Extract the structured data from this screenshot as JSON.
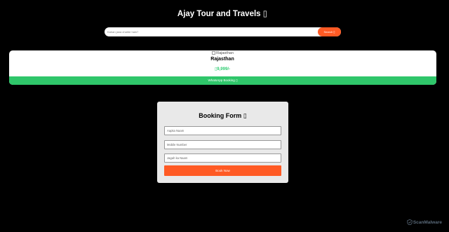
{
  "header": {
    "title": "Ajay Tour and Travels ▯"
  },
  "search": {
    "placeholder": "Kahan jana chahte hain?",
    "button_label": "Search ▯"
  },
  "package": {
    "image_alt": "Rajasthan",
    "name": "Rajasthan",
    "price": "▯9,999/-",
    "whatsapp_label": "WhatsApp Booking ▯",
    "colors": {
      "price": "#2ecc71",
      "whatsapp": "#2fc66a"
    }
  },
  "booking": {
    "title": "Booking Form ▯",
    "name_placeholder": "Aapka Naam",
    "mobile_placeholder": "Mobile Number",
    "place_placeholder": "Jagah ka Naam",
    "submit_label": "Book Now"
  },
  "watermark": {
    "text": "ScanMalware"
  },
  "colors": {
    "accent": "#ff5a24",
    "background": "#000000"
  }
}
